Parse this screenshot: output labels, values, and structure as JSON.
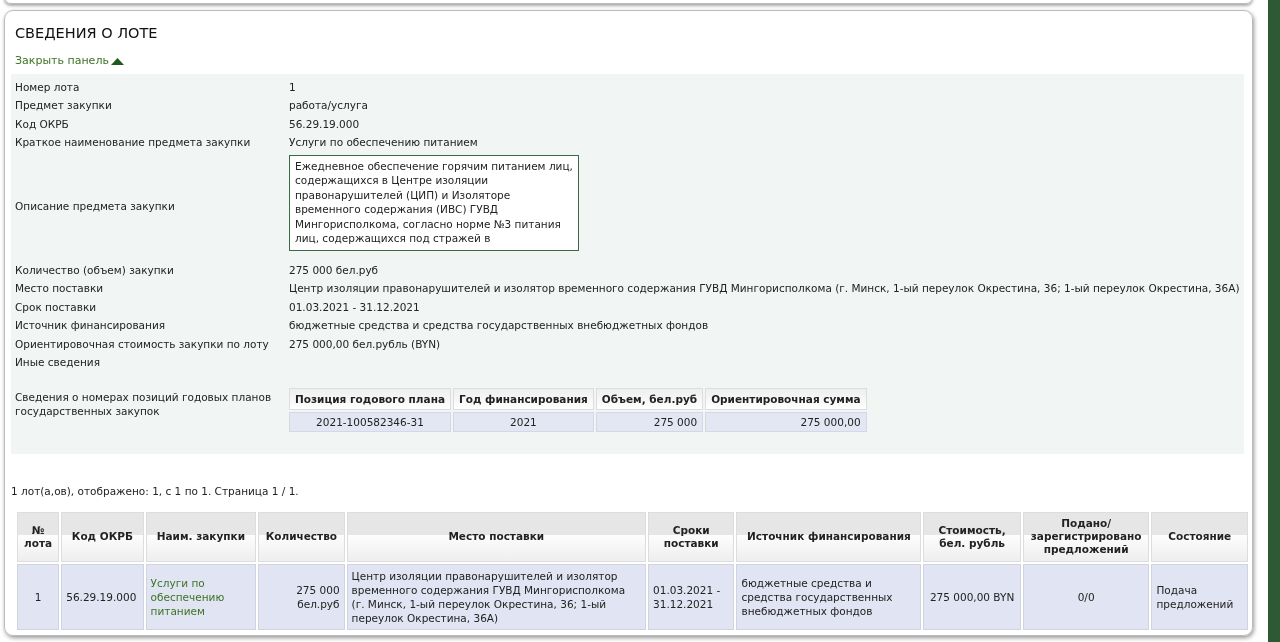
{
  "panel": {
    "title": "СВЕДЕНИЯ О ЛОТЕ",
    "toggle_link": "Закрыть панель",
    "expanded": true
  },
  "details": [
    {
      "kind": "text",
      "label": "Номер лота",
      "value": "1"
    },
    {
      "kind": "text",
      "label": "Предмет закупки",
      "value": "работа/услуга"
    },
    {
      "kind": "text",
      "label": "Код ОКРБ",
      "value": "56.29.19.000"
    },
    {
      "kind": "text",
      "label": "Краткое наименование предмета закупки",
      "value": "Услуги по обеспечению питанием"
    },
    {
      "kind": "textarea",
      "label": "Описание предмета закупки",
      "value": "Ежедневное обеспечение горячим питанием лиц, содержащихся в Центре изоляции правонарушителей (ЦИП) и Изоляторе временного содержания (ИВС) ГУВД Мингорисполкома, согласно норме №3 питания лиц, содержащихся под стражей в"
    },
    {
      "kind": "text",
      "label": "Количество (объем) закупки",
      "value": "275 000 бел.руб"
    },
    {
      "kind": "text",
      "label": "Место поставки",
      "value": "Центр изоляции правонарушителей и изолятор временного содержания ГУВД Мингорисполкома (г. Минск, 1-ый переулок Окрестина, 36; 1-ый переулок Окрестина, 36А)"
    },
    {
      "kind": "text",
      "label": "Срок поставки",
      "value": "01.03.2021 - 31.12.2021"
    },
    {
      "kind": "text",
      "label": "Источник финансирования",
      "value": "бюджетные средства и средства государственных внебюджетных фондов"
    },
    {
      "kind": "text",
      "label": "Ориентировочная стоимость закупки по лоту",
      "value": "275 000,00 бел.рубль (BYN)"
    },
    {
      "kind": "text",
      "label": "Иные сведения"
    },
    {
      "kind": "table",
      "label": "Сведения о номерах позиций годовых планов государственных закупок",
      "columns": [
        "Позиция годового плана",
        "Год финансирования",
        "Объем, бел.руб",
        "Ориентировочная сумма"
      ],
      "rows": [
        [
          "2021-100582346-31",
          "2021",
          "275 000",
          "275 000,00"
        ]
      ]
    }
  ],
  "summary": "1 лот(а,ов), отображено: 1, с 1 по 1. Страница 1 / 1.",
  "lots_table": {
    "columns": [
      "№ лота",
      "Код ОКРБ",
      "Наим. закупки",
      "Количество",
      "Место поставки",
      "Сроки поставки",
      "Источник финансирования",
      "Стоимость, бел. рубль",
      "Подано/ зарегистрировано предложений",
      "Состояние"
    ],
    "rows": [
      [
        {
          "kind": "text",
          "text": "1"
        },
        {
          "kind": "text",
          "text": "56.29.19.000"
        },
        {
          "kind": "link",
          "text": "Услуги по обеспечению питанием"
        },
        {
          "kind": "text",
          "text": "275 000 бел.руб"
        },
        {
          "kind": "text",
          "text": "Центр изоляции правонарушителей и изолятор временного содержания ГУВД Мингорисполкома (г. Минск, 1-ый переулок Окрестина, 36; 1-ый переулок Окрестина, 36А)"
        },
        {
          "kind": "text",
          "text": "01.03.2021 - 31.12.2021"
        },
        {
          "kind": "text",
          "text": "бюджетные средства и средства государственных внебюджетных фондов"
        },
        {
          "kind": "text",
          "text": "275 000,00 BYN"
        },
        {
          "kind": "text",
          "text": "0/0"
        },
        {
          "kind": "text",
          "text": "Подача предложений"
        }
      ]
    ]
  }
}
